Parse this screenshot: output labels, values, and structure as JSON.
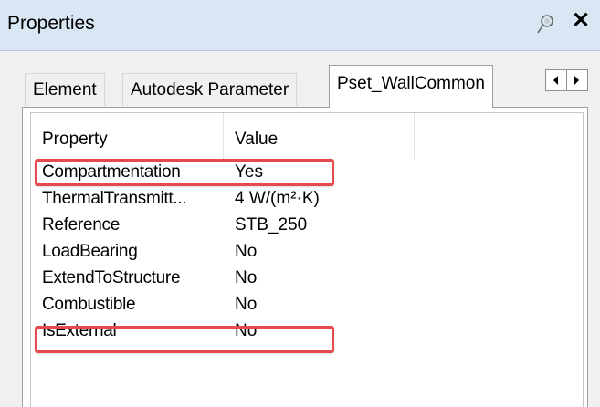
{
  "window": {
    "title": "Properties"
  },
  "tabs": [
    {
      "label": "Element"
    },
    {
      "label": "Autodesk Parameter"
    },
    {
      "label": "Pset_WallCommon"
    }
  ],
  "table": {
    "headers": {
      "property": "Property",
      "value": "Value"
    },
    "rows": [
      {
        "property": "Compartmentation",
        "value": "Yes",
        "highlighted": true
      },
      {
        "property": "ThermalTransmitt...",
        "value": "4 W/(m²·K)",
        "highlighted": false
      },
      {
        "property": "Reference",
        "value": "STB_250",
        "highlighted": false
      },
      {
        "property": "LoadBearing",
        "value": "No",
        "highlighted": false
      },
      {
        "property": "ExtendToStructure",
        "value": "No",
        "highlighted": false
      },
      {
        "property": "Combustible",
        "value": "No",
        "highlighted": true
      },
      {
        "property": "IsExternal",
        "value": "No",
        "highlighted": false
      }
    ]
  },
  "colors": {
    "highlight": "#e8474f",
    "titlebar": "#d9e6f3"
  },
  "icons": {
    "pin": "pin-icon",
    "close": "close-icon",
    "left": "chevron-left-icon",
    "right": "chevron-right-icon"
  }
}
